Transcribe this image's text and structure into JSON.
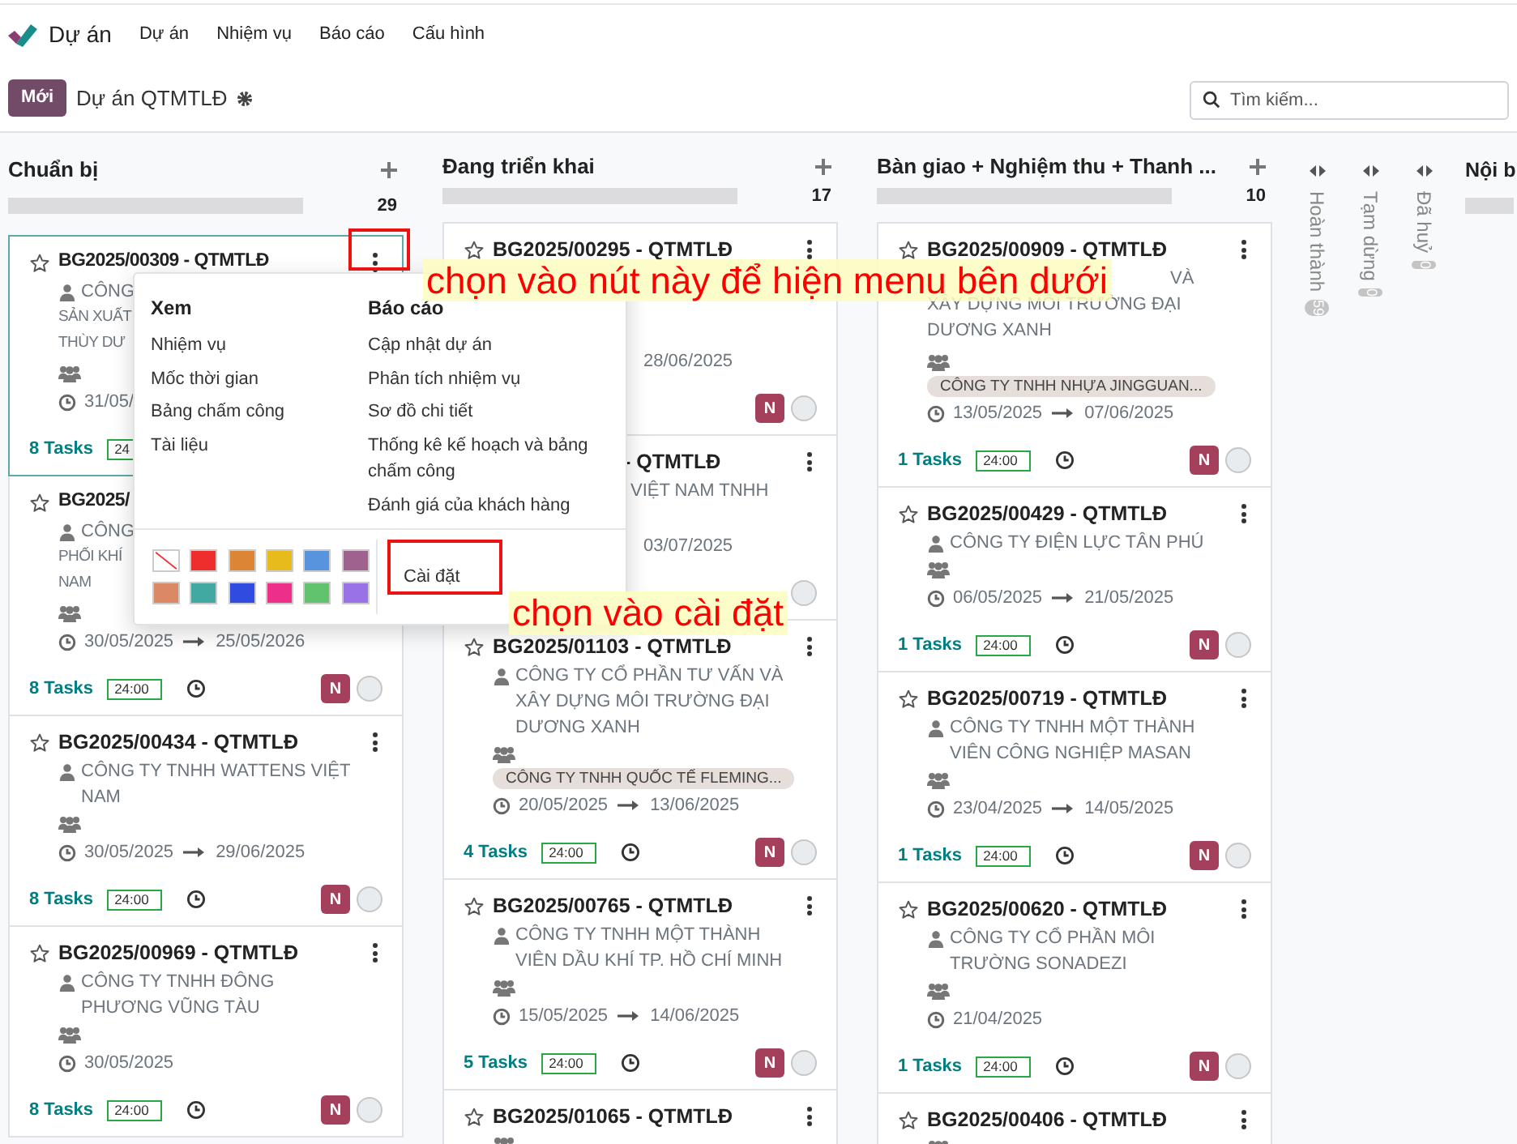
{
  "app": {
    "name": "Dự án",
    "menu": [
      "Dự án",
      "Nhiệm vụ",
      "Báo cáo",
      "Cấu hình"
    ]
  },
  "control_bar": {
    "new_button": "Mới",
    "breadcrumb": "Dự án QTMTLĐ",
    "search": {
      "placeholder": "Tìm kiếm..."
    }
  },
  "columns": [
    {
      "title": "Chuẩn bị",
      "count": "29",
      "level": 1,
      "cards": [
        {
          "kind": "menu_left_top",
          "title": "BG2025/00309 - QTMTLĐ",
          "partner_head": "CÔNG",
          "partner": "SẢN XUẤT\nTHÙY DƯ",
          "date_start": "31/05/",
          "tasks": "8 Tasks",
          "timesheet": "24",
          "highlighted": true
        },
        {
          "kind": "menu_left",
          "title": "BG2025/",
          "partner_head": "CÔNG",
          "partner": "PHỐI KHÍ\nNAM",
          "date_start": "30/05/2025",
          "date_end": "25/05/2026",
          "tasks": "8 Tasks",
          "timesheet": "24:00",
          "avatar": "N",
          "highlighted": false
        },
        {
          "kind": "plain",
          "title": "BG2025/00434 - QTMTLĐ",
          "partner": "CÔNG TY TNHH WATTENS VIỆT\nNAM",
          "date_start": "30/05/2025",
          "date_end": "29/06/2025",
          "tasks": "8 Tasks",
          "timesheet": "24:00",
          "avatar": "N",
          "highlighted": false
        },
        {
          "kind": "plain",
          "title": "BG2025/00969 - QTMTLĐ",
          "partner": "CÔNG TY TNHH ĐÔNG\nPHƯƠNG VŨNG TÀU",
          "date_start": "30/05/2025",
          "tasks": "8 Tasks",
          "timesheet": "24:00",
          "avatar": "N",
          "highlighted": false
        }
      ]
    },
    {
      "title": "Đang triển khai",
      "count": "17",
      "level": 1,
      "cards": [
        {
          "kind": "callout_menu",
          "title": "BG2025/00295 - QTMTLĐ",
          "date_end": "28/06/2025",
          "avatar": "N",
          "highlighted": false
        },
        {
          "kind": "menu_right",
          "title": "- QTMTLĐ",
          "partner_head": "VIỆT NAM TNHH",
          "date_end": "03/07/2025",
          "highlighted": false
        },
        {
          "kind": "plain",
          "title": "BG2025/01103 - QTMTLĐ",
          "partner": "CÔNG TY CỔ PHẦN TƯ VẤN VÀ\nXÂY DỰNG MÔI TRƯỜNG ĐẠI\nDƯƠNG XANH",
          "tag": "CÔNG TY TNHH QUỐC TẾ FLEMING...",
          "date_start": "20/05/2025",
          "date_end": "13/06/2025",
          "tasks": "4 Tasks",
          "timesheet": "24:00",
          "avatar": "N",
          "highlighted": false
        },
        {
          "kind": "plain",
          "title": "BG2025/00765 - QTMTLĐ",
          "partner": "CÔNG TY TNHH MỘT THÀNH\nVIÊN DẦU KHÍ TP. HỒ CHÍ MINH",
          "date_start": "15/05/2025",
          "date_end": "14/06/2025",
          "tasks": "5 Tasks",
          "timesheet": "24:00",
          "avatar": "N",
          "highlighted": false
        },
        {
          "kind": "plain",
          "title": "BG2025/01065 - QTMTLĐ",
          "highlighted": false
        }
      ]
    },
    {
      "title": "Bàn giao + Nghiệm thu + Thanh ...",
      "count": "10",
      "level": 1,
      "cards": [
        {
          "kind": "callout",
          "title": "BG2025/00909 - QTMTLĐ",
          "partner_head": "VÀ",
          "partner": "XÂY DỰNG MÔI TRƯỜNG ĐẠI\nDƯƠNG XANH",
          "tag": "CÔNG TY TNHH NHỰA JINGGUAN...",
          "date_start": "13/05/2025",
          "date_end": "07/06/2025",
          "tasks": "1 Tasks",
          "timesheet": "24:00",
          "avatar": "N",
          "highlighted": false
        },
        {
          "kind": "plain",
          "title": "BG2025/00429 - QTMTLĐ",
          "partner": "CÔNG TY ĐIỆN LỰC TÂN PHÚ",
          "date_start": "06/05/2025",
          "date_end": "21/05/2025",
          "tasks": "1 Tasks",
          "timesheet": "24:00",
          "avatar": "N",
          "highlighted": false
        },
        {
          "kind": "plain",
          "title": "BG2025/00719 - QTMTLĐ",
          "partner": "CÔNG TY TNHH MỘT THÀNH\nVIÊN CÔNG NGHIỆP MASAN",
          "date_start": "23/04/2025",
          "date_end": "14/05/2025",
          "tasks": "1 Tasks",
          "timesheet": "24:00",
          "avatar": "N",
          "highlighted": false
        },
        {
          "kind": "plain",
          "title": "BG2025/00620 - QTMTLĐ",
          "partner": "CÔNG TY CỔ PHẦN MÔI\nTRƯỜNG SONADEZI",
          "date_start": "21/04/2025",
          "tasks": "1 Tasks",
          "timesheet": "24:00",
          "avatar": "N",
          "highlighted": false
        },
        {
          "kind": "plain",
          "title": "BG2025/00406 - QTMTLĐ",
          "highlighted": false
        }
      ]
    }
  ],
  "folded_columns": [
    {
      "title": "Hoàn thành",
      "count": "59"
    },
    {
      "title": "Tạm dừng",
      "count": "0"
    },
    {
      "title": "Đã huỷ",
      "count": "0"
    }
  ],
  "cut_column": {
    "title": "Nội b",
    "level": 1
  },
  "dropdown": {
    "left": {
      "heading": "Xem",
      "items": [
        "Nhiệm vụ",
        "Mốc thời gian",
        "Bảng chấm công",
        "Tài liệu"
      ]
    },
    "right": {
      "heading": "Báo cáo",
      "items": [
        "Cập nhật dự án",
        "Phân tích nhiệm vụ",
        "Sơ đồ chi tiết",
        "Thống kê kế hoạch và bảng chấm công",
        "Đánh giá của khách hàng"
      ]
    },
    "swatches": [
      {
        "kind": "none"
      },
      {
        "kind": "color",
        "color": "#ee2d2d"
      },
      {
        "kind": "color",
        "color": "#dc8534"
      },
      {
        "kind": "color",
        "color": "#e8bb1d"
      },
      {
        "kind": "color",
        "color": "#5794dd"
      },
      {
        "kind": "color",
        "color": "#9f628f"
      },
      {
        "kind": "color",
        "color": "#db8865"
      },
      {
        "kind": "color",
        "color": "#41a9a2"
      },
      {
        "kind": "color",
        "color": "#304be0"
      },
      {
        "kind": "color",
        "color": "#ee2f8a"
      },
      {
        "kind": "color",
        "color": "#61c36e"
      },
      {
        "kind": "color",
        "color": "#9872e6"
      }
    ],
    "settings": "Cài đặt"
  },
  "annotations": [
    "chọn vào nút này để hiện menu bên dưới",
    "chọn vào cài đặt"
  ]
}
